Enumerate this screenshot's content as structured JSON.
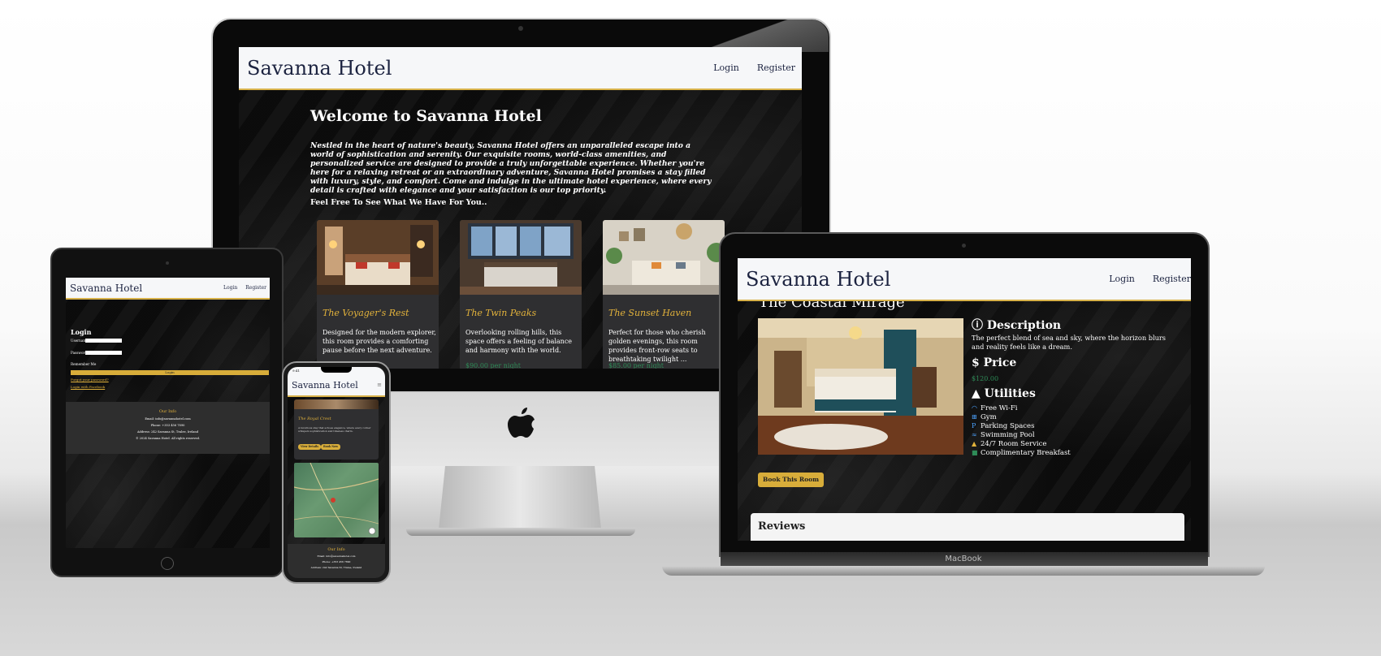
{
  "site": {
    "brand": "Savanna Hotel",
    "nav": {
      "login": "Login",
      "register": "Register"
    }
  },
  "desktop": {
    "welcome_title": "Welcome to Savanna Hotel",
    "welcome_text": "Nestled in the heart of nature's beauty, Savanna Hotel offers an unparalleled escape into a world of sophistication and serenity. Our exquisite rooms, world-class amenities, and personalized service are designed to provide a truly unforgettable experience. Whether you're here for a relaxing retreat or an extraordinary adventure, Savanna Hotel promises a stay filled with luxury, style, and comfort. Come and indulge in the ultimate hotel experience, where every detail is crafted with elegance and your satisfaction is our top priority.",
    "welcome_sub": "Feel Free To See What We Have For You..",
    "rooms": [
      {
        "name": "The Voyager's Rest",
        "description": "Designed for the modern explorer, this room provides a comforting pause before the next adventure."
      },
      {
        "name": "The Twin Peaks",
        "description": "Overlooking rolling hills, this space offers a feeling of balance and harmony with the world.",
        "price": "$90.00 per night"
      },
      {
        "name": "The Sunset Haven",
        "description": "Perfect for those who cherish golden evenings, this room provides front-row seats to breathtaking twilight ...",
        "price": "$85.00 per night"
      }
    ]
  },
  "tablet": {
    "login_title": "Login",
    "username_label": "Username",
    "password_label": "Password",
    "remember_label": "Remember Me",
    "login_button": "Login",
    "forgot_link": "Forgot your password?",
    "facebook_link": "Login with Facebook",
    "footer": {
      "title": "Our Info",
      "email": "Email: info@savannahotel.com",
      "phone": "Phone: +353 456 7890",
      "address": "Address: 242 Savanna St, Tralee, Ireland",
      "copyright": "© 2024 Savanna Hotel. All rights reserved."
    }
  },
  "phone": {
    "time": "9:41",
    "menu_icon": "≡",
    "card_title": "The Royal Crest",
    "card_desc": "A luxurious stay that echoes elegance, where every corner whispers sophistication and timeless charm.",
    "view_details": "View Details",
    "book_now": "Book Now",
    "footer": {
      "title": "Our Info",
      "email": "Email: info@savannahotel.com",
      "phone": "Phone: +353 456 7890",
      "address": "Address: 242 Savanna St, Tralee, Ireland"
    }
  },
  "laptop": {
    "room_title": "The Coastal Mirage",
    "description_heading": "Description",
    "description": "The perfect blend of sea and sky, where the horizon blurs and reality feels like a dream.",
    "price_heading": "Price",
    "price": "$120.00",
    "utilities_heading": "Utilities",
    "utilities": [
      {
        "icon": "wifi-icon",
        "glyph": "◠",
        "label": "Free Wi-Fi"
      },
      {
        "icon": "gym-icon",
        "glyph": "⊞",
        "label": "Gym"
      },
      {
        "icon": "parking-icon",
        "glyph": "P",
        "label": "Parking Spaces"
      },
      {
        "icon": "pool-icon",
        "glyph": "≈",
        "label": "Swimming Pool"
      },
      {
        "icon": "bell-icon",
        "glyph": "▲",
        "label": "24/7 Room Service"
      },
      {
        "icon": "breakfast-icon",
        "glyph": "■",
        "label": "Complimentary Breakfast"
      }
    ],
    "book_button": "Book This Room",
    "reviews_heading": "Reviews",
    "device_label": "MacBook"
  },
  "colors": {
    "accent_gold": "#d8ad3a",
    "navy": "#1c2340",
    "price_green": "#2e8b57"
  }
}
